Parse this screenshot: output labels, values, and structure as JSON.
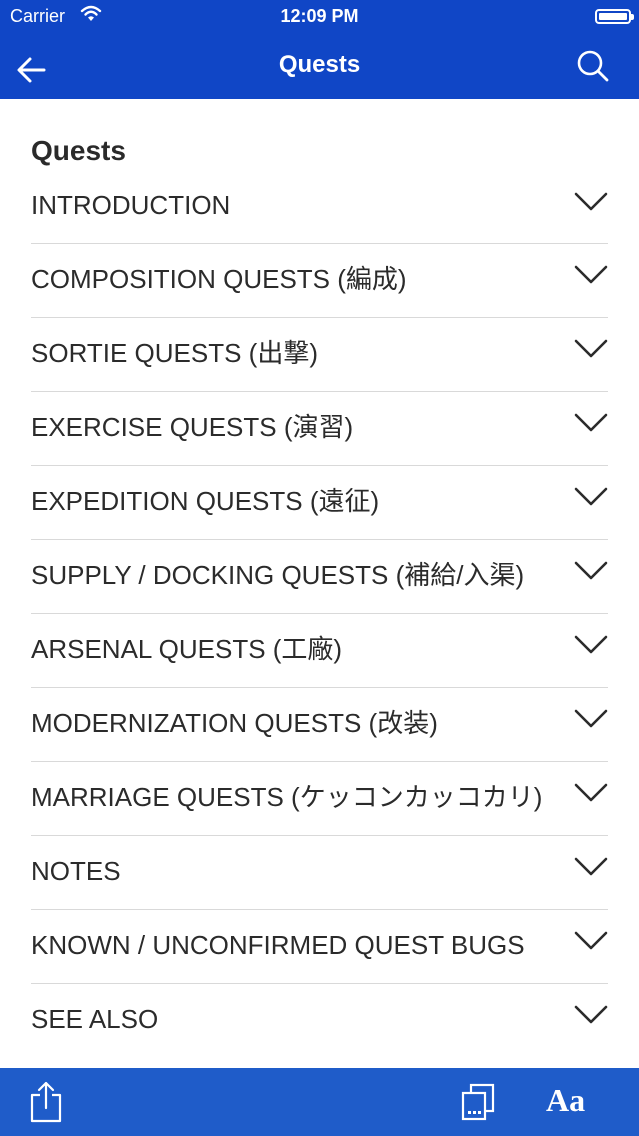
{
  "status_bar": {
    "carrier": "Carrier",
    "time": "12:09 PM"
  },
  "nav": {
    "title": "Quests",
    "back_icon": "arrow-left-icon",
    "search_icon": "search-icon"
  },
  "content": {
    "heading": "Quests",
    "sections": [
      "INTRODUCTION",
      "COMPOSITION QUESTS (編成)",
      "SORTIE QUESTS (出撃)",
      "EXERCISE QUESTS (演習)",
      "EXPEDITION QUESTS (遠征)",
      "SUPPLY / DOCKING QUESTS (補給/入渠)",
      "ARSENAL QUESTS (工廠)",
      "MODERNIZATION QUESTS (改装)",
      "MARRIAGE QUESTS (ケッコンカッコカリ)",
      "NOTES",
      "KNOWN / UNCONFIRMED QUEST BUGS",
      "SEE ALSO"
    ]
  },
  "toolbar": {
    "share_icon": "share-icon",
    "pages_icon": "pages-icon",
    "font_label": "Aa"
  },
  "colors": {
    "header_bg": "#1046c6",
    "toolbar_bg": "#1f5cc9",
    "text": "#2b2b2b",
    "divider": "#d9d9d9"
  }
}
